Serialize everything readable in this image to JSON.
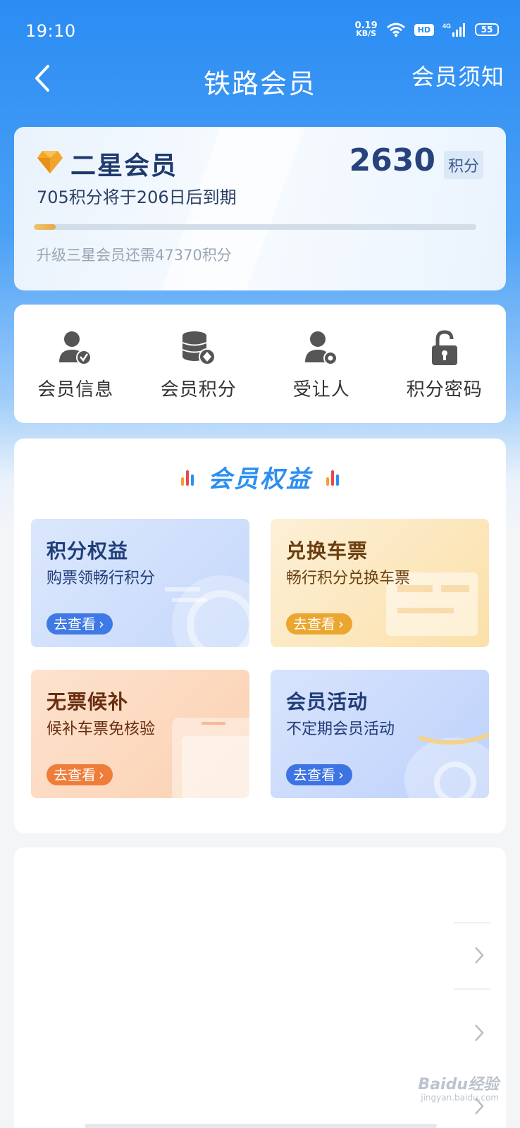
{
  "status_bar": {
    "time": "19:10",
    "net_speed_value": "0.19",
    "net_speed_unit": "KB/S",
    "hd_label": "HD",
    "network_label": "4G",
    "battery": "55"
  },
  "nav": {
    "title": "铁路会员",
    "notice": "会员须知"
  },
  "member_card": {
    "level": "二星会员",
    "points": "2630",
    "points_unit": "积分",
    "expiry": "705积分将于206日后到期",
    "upgrade_hint": "升级三星会员还需47370积分",
    "progress_fraction": 0.05
  },
  "quick_menu": [
    {
      "label": "会员信息",
      "icon": "user-verified-icon"
    },
    {
      "label": "会员积分",
      "icon": "coins-stack-icon"
    },
    {
      "label": "受让人",
      "icon": "user-settings-icon"
    },
    {
      "label": "积分密码",
      "icon": "unlock-icon"
    }
  ],
  "benefits": {
    "title": "会员权益",
    "tiles": [
      {
        "title": "积分权益",
        "subtitle": "购票领畅行积分",
        "button": "去查看"
      },
      {
        "title": "兑换车票",
        "subtitle": "畅行积分兑换车票",
        "button": "去查看"
      },
      {
        "title": "无票候补",
        "subtitle": "候补车票免核验",
        "button": "去查看"
      },
      {
        "title": "会员活动",
        "subtitle": "不定期会员活动",
        "button": "去查看"
      }
    ]
  },
  "watermark": {
    "text": "Baidu经验",
    "sub": "jingyan.baidu.com"
  },
  "colors": {
    "header_blue": "#2b8cf3",
    "accent_gold": "#eba62f",
    "title_blue": "#2c8ff0"
  }
}
